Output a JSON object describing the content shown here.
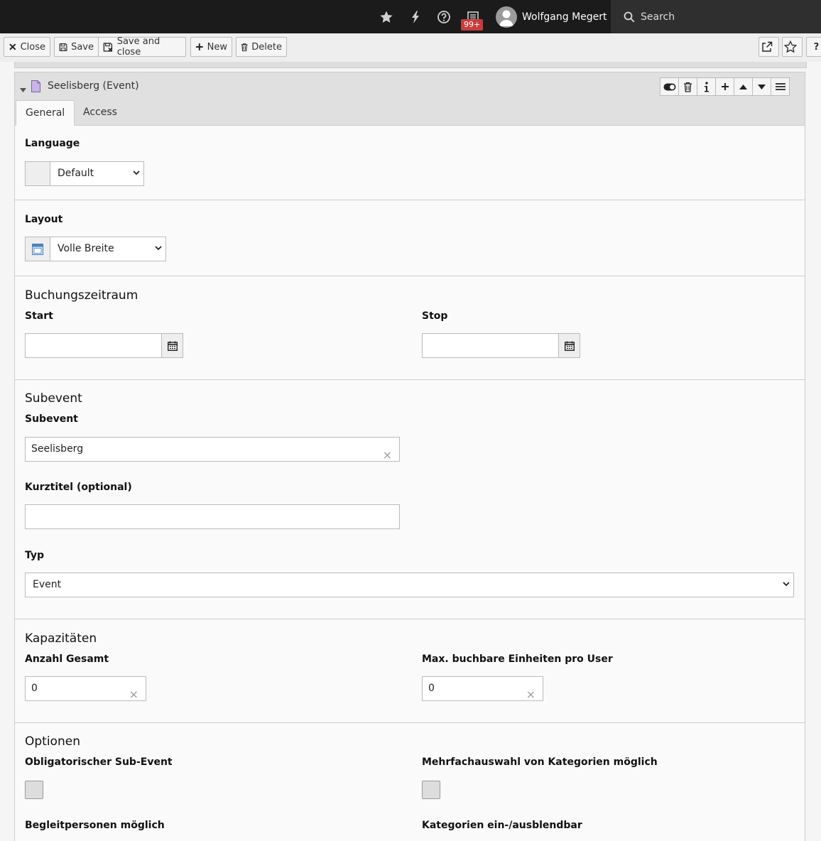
{
  "topbar": {
    "notification_count": "99+",
    "user_name": "Wolfgang Megert",
    "search_label": "Search"
  },
  "toolbar": {
    "close_label": "Close",
    "save_label": "Save",
    "save_close_label": "Save and close",
    "new_label": "New",
    "delete_label": "Delete",
    "help_label": "?"
  },
  "record": {
    "title": "Seelisberg (Event)"
  },
  "tabs": [
    {
      "label": "General"
    },
    {
      "label": "Access"
    }
  ],
  "form": {
    "language_label": "Language",
    "language_value": "Default",
    "layout_label": "Layout",
    "layout_value": "Volle Breite",
    "booking_legend": "Buchungszeitraum",
    "start_label": "Start",
    "stop_label": "Stop",
    "subevent_legend": "Subevent",
    "subevent_label": "Subevent",
    "subevent_value": "Seelisberg",
    "shorttitle_label": "Kurztitel (optional)",
    "type_label": "Typ",
    "type_value": "Event",
    "capacity_legend": "Kapazitäten",
    "total_label": "Anzahl Gesamt",
    "total_value": "0",
    "max_label": "Max. buchbare Einheiten pro User",
    "max_value": "0",
    "options_legend": "Optionen",
    "mandatory_label": "Obligatorischer Sub-Event",
    "multiselect_label": "Mehrfachauswahl von Kategorien möglich",
    "companions_label": "Begleitpersonen möglich",
    "categories_toggle_label": "Kategorien ein-/ausblendbar"
  }
}
